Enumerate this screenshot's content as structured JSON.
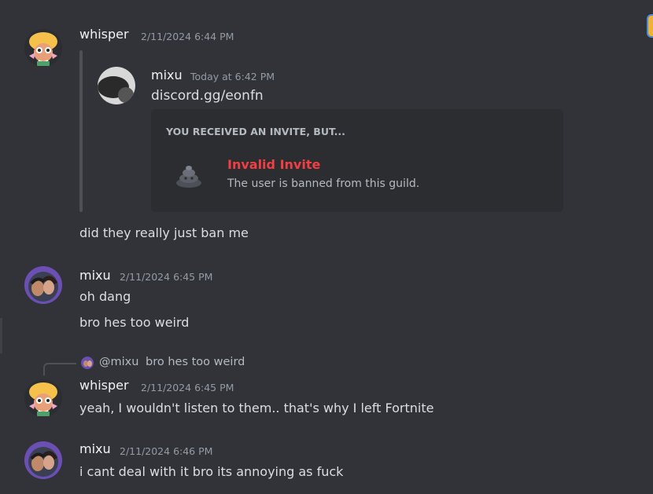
{
  "messages": [
    {
      "author": "whisper",
      "timestamp": "2/11/2024 6:44 PM",
      "forward": {
        "author": "mixu",
        "timestamp": "Today at 6:42 PM",
        "text": "discord.gg/eonfn",
        "invite": {
          "header": "YOU RECEIVED AN INVITE, BUT...",
          "title": "Invalid Invite",
          "description": "The user is banned from this guild."
        }
      },
      "followup": "did they really just ban me"
    },
    {
      "author": "mixu",
      "timestamp": "2/11/2024 6:45 PM",
      "lines": [
        "oh dang",
        "bro hes too weird"
      ]
    },
    {
      "reply": {
        "mention": "@mixu",
        "text": "bro hes too weird"
      },
      "author": "whisper",
      "timestamp": "2/11/2024 6:45 PM",
      "text": "yeah, I wouldn't listen to them.. that's why I left Fortnite"
    },
    {
      "author": "mixu",
      "timestamp": "2/11/2024 6:46 PM",
      "text": "i cant deal with it bro its annoying as fuck"
    }
  ],
  "colors": {
    "background": "#313338",
    "embed": "#2b2d31",
    "invalid": "#f23f43",
    "username": "#f2f3f5",
    "timestamp": "#949ba4"
  }
}
